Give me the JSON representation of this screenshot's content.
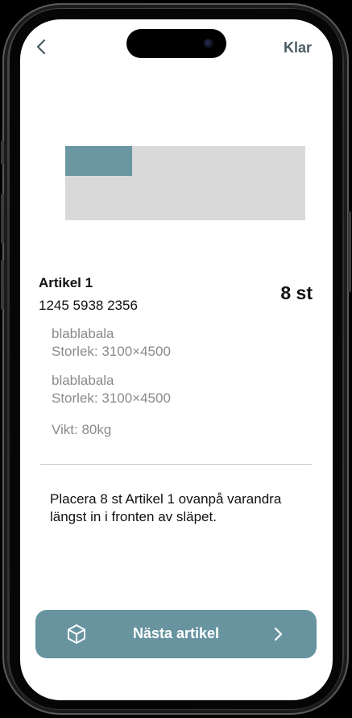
{
  "header": {
    "back_icon": "chevron-left-icon",
    "done_label": "Klar"
  },
  "diagram": {
    "area_color": "#d9d9d9",
    "box_color": "#6a97a1"
  },
  "article": {
    "name": "Artikel 1",
    "number": "1245 5938 2356",
    "quantity": "8 st",
    "details": [
      {
        "description": "blablabala",
        "size": "Storlek: 3100×4500"
      },
      {
        "description": "blablabala",
        "size": "Storlek: 3100×4500"
      }
    ],
    "weight": "Vikt: 80kg"
  },
  "instruction": "Placera 8 st Artikel 1 ovanpå varandra längst in i fronten av släpet.",
  "next_button": {
    "label": "Nästa artikel",
    "icon": "box-icon",
    "arrow_icon": "chevron-right-icon",
    "color": "#6894a0"
  }
}
